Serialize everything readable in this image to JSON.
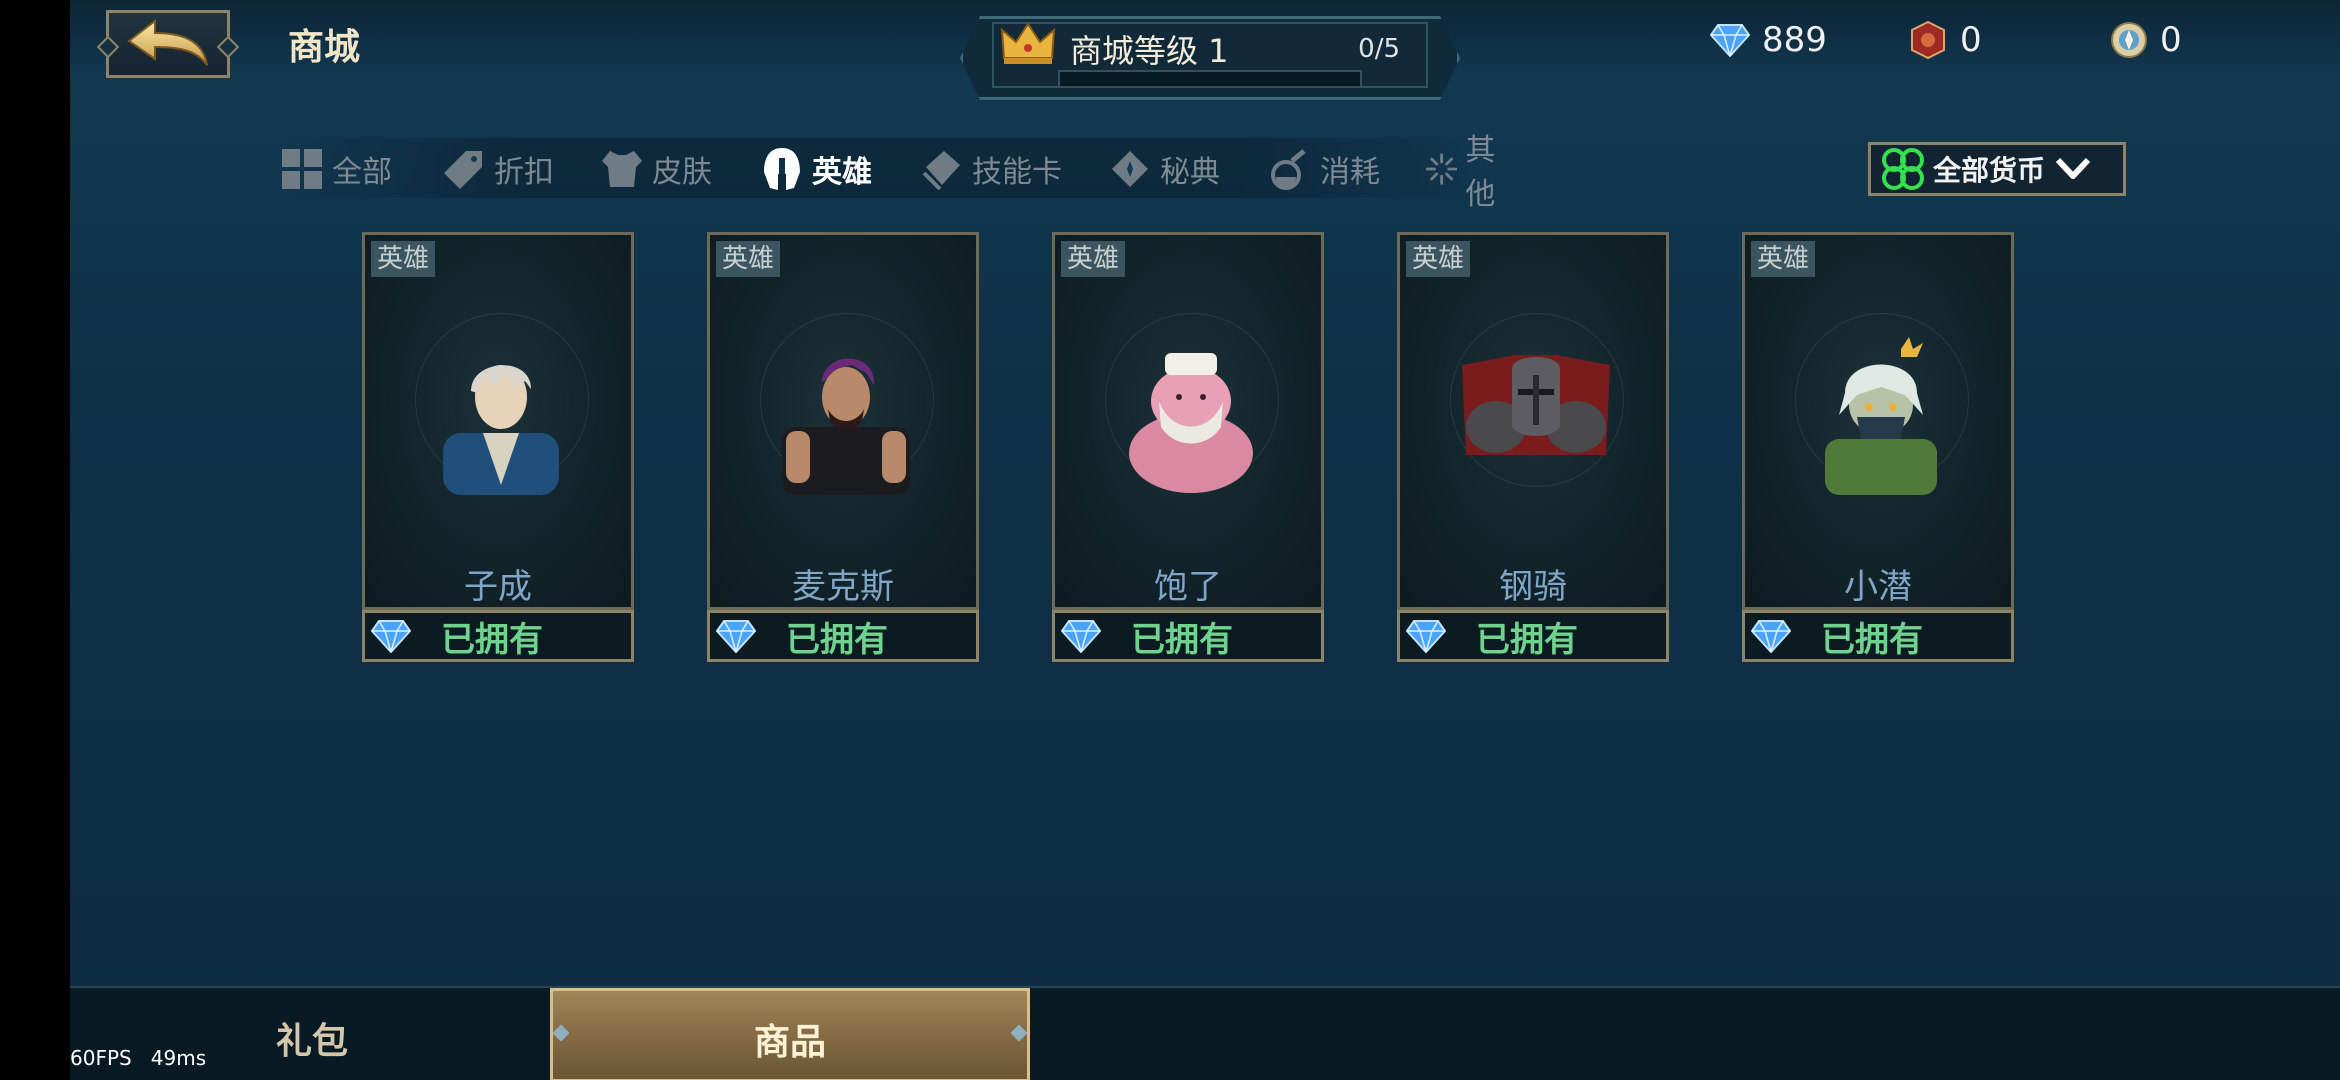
{
  "header": {
    "title": "商城",
    "level_label": "商城等级 1",
    "level_progress": "0/5",
    "level_fraction": 0.0
  },
  "currencies": [
    {
      "icon": "diamond-icon",
      "value": "889"
    },
    {
      "icon": "rune-coin-icon",
      "value": "0"
    },
    {
      "icon": "compass-coin-icon",
      "value": "0"
    }
  ],
  "categories": [
    {
      "label": "全部",
      "icon": "grid-icon"
    },
    {
      "label": "折扣",
      "icon": "tag-icon"
    },
    {
      "label": "皮肤",
      "icon": "armor-icon"
    },
    {
      "label": "英雄",
      "icon": "helmet-icon",
      "active": true
    },
    {
      "label": "技能卡",
      "icon": "card-icon"
    },
    {
      "label": "秘典",
      "icon": "book-icon"
    },
    {
      "label": "消耗",
      "icon": "potion-icon"
    },
    {
      "label": "其他",
      "icon": "sparkle-icon"
    }
  ],
  "currency_filter": {
    "label": "全部货币",
    "icon": "clover-icon"
  },
  "heroes": [
    {
      "tag": "英雄",
      "name": "子成",
      "status": "已拥有"
    },
    {
      "tag": "英雄",
      "name": "麦克斯",
      "status": "已拥有"
    },
    {
      "tag": "英雄",
      "name": "饱了",
      "status": "已拥有"
    },
    {
      "tag": "英雄",
      "name": "钢骑",
      "status": "已拥有"
    },
    {
      "tag": "英雄",
      "name": "小潜",
      "status": "已拥有"
    }
  ],
  "bottom_tabs": [
    {
      "label": "礼包"
    },
    {
      "label": "商品",
      "active": true
    }
  ],
  "debug": {
    "fps": "60FPS",
    "latency": "49ms"
  },
  "colors": {
    "accent_gold": "#caa756",
    "owned_green": "#6fd38f",
    "name_blue": "#7fa6c8"
  }
}
